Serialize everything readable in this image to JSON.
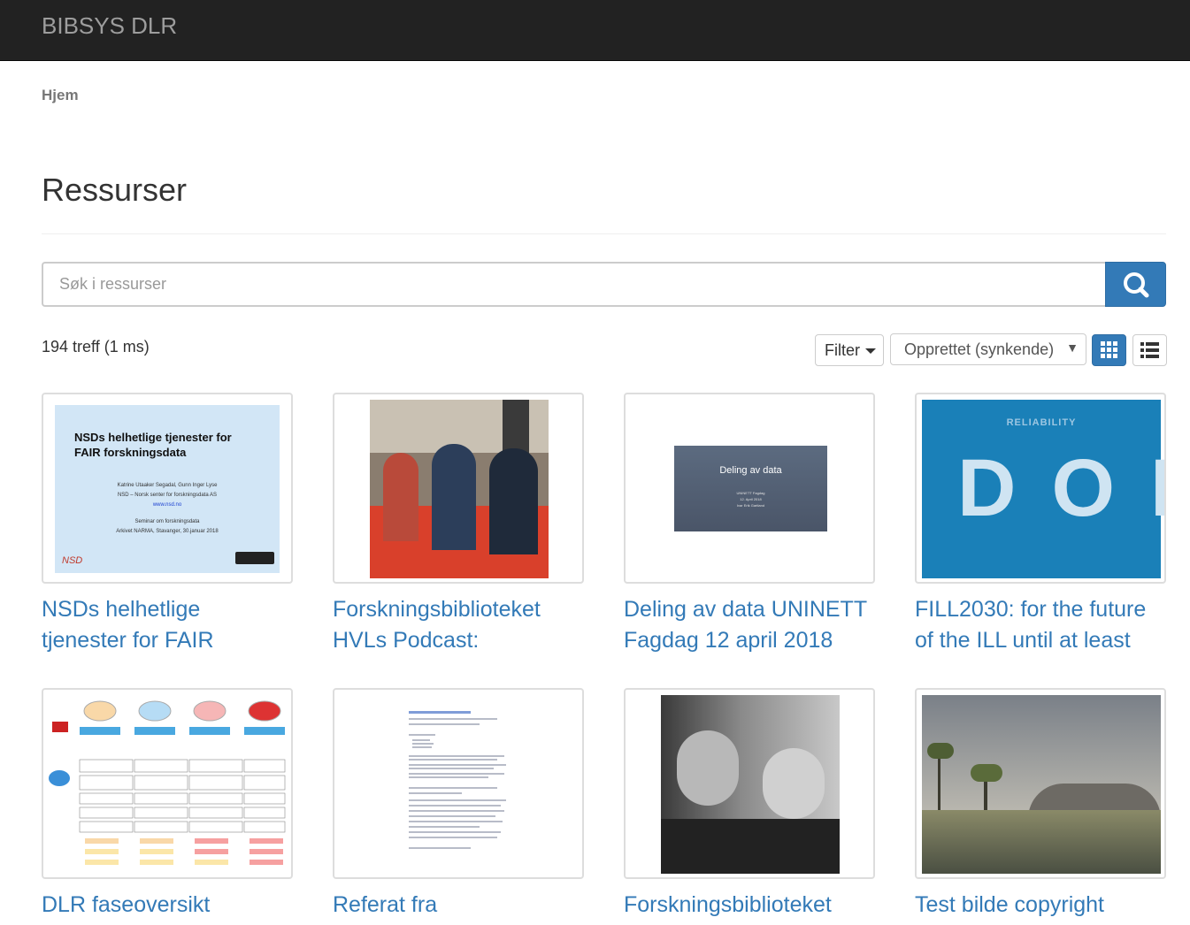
{
  "app": {
    "brand": "BIBSYS DLR"
  },
  "breadcrumb": {
    "home": "Hjem"
  },
  "page": {
    "title": "Ressurser"
  },
  "search": {
    "placeholder": "Søk i ressurser"
  },
  "results": {
    "count_text": "194 treff (1 ms)"
  },
  "toolbar": {
    "filter_label": "Filter",
    "sort_label": "Opprettet (synkende)",
    "view_grid_icon": "grid-icon",
    "view_list_icon": "list-icon"
  },
  "colors": {
    "accent": "#337ab7",
    "navbar": "#222222",
    "link": "#337ab7"
  },
  "resources": [
    {
      "title_line1": "NSDs helhetlige",
      "title_line2": "tjenester for FAIR",
      "thumb": {
        "heading1": "NSDs helhetlige tjenester for",
        "heading2": "FAIR forskningsdata",
        "authors": "Katrine Utaaker Segadal, Gunn Inger Lyse",
        "org": "NSD – Norsk senter for forskningsdata AS",
        "url": "www.nsd.no",
        "event": "Seminar om forskningsdata",
        "venue": "Arkivet NARMA, Stavanger, 30.januar 2018",
        "logo": "NSD"
      }
    },
    {
      "title_line1": "Forskningsbiblioteket",
      "title_line2": "HVLs Podcast:"
    },
    {
      "title_line1": "Deling av data UNINETT",
      "title_line2": "Fagdag 12 april 2018",
      "thumb": {
        "heading": "Deling av data",
        "sub1": "UNINETT Fagdag",
        "sub2": "12. April 2018",
        "sub3": "Ivar Erik Gartland"
      }
    },
    {
      "title_line1": "FILL2030: for the future",
      "title_line2": "of the ILL until at least",
      "thumb": {
        "caption": "RELIABILITY",
        "letters": "DOI"
      }
    },
    {
      "title_line1": "DLR faseoversikt",
      "title_line2": ""
    },
    {
      "title_line1": "Referat fra",
      "title_line2": ""
    },
    {
      "title_line1": "Forskningsbiblioteket",
      "title_line2": ""
    },
    {
      "title_line1": "Test bilde copyright",
      "title_line2": ""
    }
  ]
}
